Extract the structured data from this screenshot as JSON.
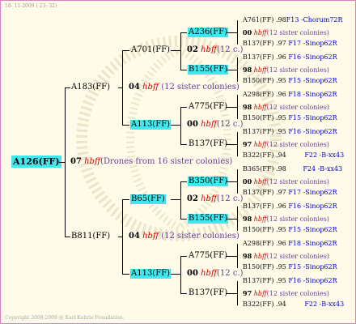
{
  "header": {
    "date": "18- 11-2009 ( 23: 32)"
  },
  "footer": {
    "copyright": "Copyright 2008-2009 @ Karl Kehrle Foundation."
  },
  "root": {
    "label": "A126(FF)",
    "mating": {
      "num": "07",
      "hbff": "hbff",
      "note": "(Drones from 16 sister colonies)"
    }
  },
  "gen1": [
    {
      "label": "A183(FF)",
      "mating": {
        "num": "04",
        "hbff": "hbff",
        "note": "(12 sister colonies)"
      }
    },
    {
      "label": "B811(FF)",
      "mating": {
        "num": "04",
        "hbff": "hbff",
        "note": "(12 sister colonies)"
      }
    }
  ],
  "gen2": [
    {
      "label": "A701(FF)",
      "mating": {
        "num": "02",
        "hbff": "hbff",
        "note": "(12 c.)"
      }
    },
    {
      "label": "A113(FF)",
      "mating": {
        "num": "00",
        "hbff": "hbff",
        "note": "(12 c.)"
      }
    },
    {
      "label": "B65(FF)",
      "mating": {
        "num": "02",
        "hbff": "hbff",
        "note": "(12 c.)"
      }
    },
    {
      "label": "A113(FF)",
      "mating": {
        "num": "00",
        "hbff": "hbff",
        "note": "(12 c.)"
      }
    }
  ],
  "gen3": [
    {
      "label": "A236(FF)",
      "mating": {
        "num": "00",
        "hbff": "hbff",
        "note": "(12 sister colonies)"
      }
    },
    {
      "label": "B155(FF)",
      "mating": {
        "num": "98",
        "hbff": "hbff",
        "note": "(12 sister colonies)"
      }
    },
    {
      "label": "A775(FF)",
      "mating": {
        "num": "98",
        "hbff": "hbff",
        "note": "(12 sister colonies)"
      }
    },
    {
      "label": "B137(FF)",
      "mating": {
        "num": "97",
        "hbff": "hbff",
        "note": "(12 sister colonies)"
      }
    },
    {
      "label": "B350(FF)",
      "mating": {
        "num": "00",
        "hbff": "hbff",
        "note": "(12 sister colonies)"
      }
    },
    {
      "label": "B155(FF)",
      "mating": {
        "num": "98",
        "hbff": "hbff",
        "note": "(12 sister colonies)"
      }
    },
    {
      "label": "A775(FF)",
      "mating": {
        "num": "98",
        "hbff": "hbff",
        "note": "(12 sister colonies)"
      }
    },
    {
      "label": "B137(FF)",
      "mating": {
        "num": "97",
        "hbff": "hbff",
        "note": "(12 sister colonies)"
      }
    }
  ],
  "gen4": [
    {
      "name": "A761(FF)",
      "year": ".98",
      "loc": "F13 -Chorum72R"
    },
    {
      "name": "B137(FF)",
      "year": ".97",
      "loc": "F17 -Sinop62R"
    },
    {
      "name": "B137(FF)",
      "year": ".96",
      "loc": "F16 -Sinop62R"
    },
    {
      "name": "B150(FF)",
      "year": ".95",
      "loc": "F15 -Sinop62R"
    },
    {
      "name": "A298(FF)",
      "year": ".96",
      "loc": "F18 -Sinop62R"
    },
    {
      "name": "B150(FF)",
      "year": ".95",
      "loc": "F15 -Sinop62R"
    },
    {
      "name": "B137(FF)",
      "year": ".95",
      "loc": "F16 -Sinop62R"
    },
    {
      "name": "B322(FF)",
      "year": ".94",
      "loc": "F22 -B-xx43"
    },
    {
      "name": "B365(FF)",
      "year": ".98",
      "loc": "F24 -B-xx43"
    },
    {
      "name": "B137(FF)",
      "year": ".97",
      "loc": "F17 -Sinop62R"
    },
    {
      "name": "B137(FF)",
      "year": ".96",
      "loc": "F16 -Sinop62R"
    },
    {
      "name": "B150(FF)",
      "year": ".95",
      "loc": "F15 -Sinop62R"
    },
    {
      "name": "A298(FF)",
      "year": ".96",
      "loc": "F18 -Sinop62R"
    },
    {
      "name": "B150(FF)",
      "year": ".95",
      "loc": "F15 -Sinop62R"
    },
    {
      "name": "B137(FF)",
      "year": ".95",
      "loc": "F16 -Sinop62R"
    },
    {
      "name": "B322(FF)",
      "year": ".94",
      "loc": "F22 -B-xx43"
    }
  ]
}
